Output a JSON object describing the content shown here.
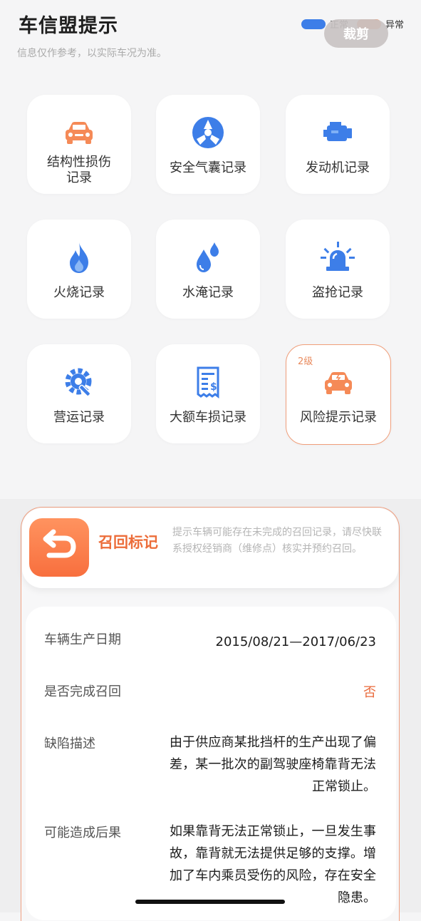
{
  "header": {
    "title": "车信盟提示",
    "subtitle": "信息仅作参考，以实际车况为准。",
    "legend": [
      {
        "label": "正常",
        "color": "#3d7ee8"
      },
      {
        "label": "异常",
        "color": "#f58a57"
      }
    ],
    "crop_button": "裁剪"
  },
  "tiles": [
    {
      "label": "结构性损伤记录",
      "icon": "car-icon",
      "status": "abnormal"
    },
    {
      "label": "安全气囊记录",
      "icon": "airbag-icon",
      "status": "normal"
    },
    {
      "label": "发动机记录",
      "icon": "engine-icon",
      "status": "normal"
    },
    {
      "label": "火烧记录",
      "icon": "fire-icon",
      "status": "normal"
    },
    {
      "label": "水淹记录",
      "icon": "water-drop-icon",
      "status": "normal"
    },
    {
      "label": "盗抢记录",
      "icon": "alarm-light-icon",
      "status": "normal"
    },
    {
      "label": "营运记录",
      "icon": "gear-wrench-icon",
      "status": "normal"
    },
    {
      "label": "大额车损记录",
      "icon": "receipt-icon",
      "status": "normal"
    },
    {
      "label": "风险提示记录",
      "icon": "car-risk-icon",
      "status": "abnormal",
      "level": "2级"
    }
  ],
  "recall": {
    "title": "召回标记",
    "description": "提示车辆可能存在未完成的召回记录，请尽快联系授权经销商（维修点）核实并预约召回。",
    "rows": [
      {
        "key": "车辆生产日期",
        "value": "2015/08/21—2017/06/23"
      },
      {
        "key": "是否完成召回",
        "value": "否"
      },
      {
        "key": "缺陷描述",
        "value": "由于供应商某批挡杆的生产出现了偏差，某一批次的副驾驶座椅靠背无法正常锁止。"
      },
      {
        "key": "可能造成后果",
        "value": "如果靠背无法正常锁止，一旦发生事故，靠背就无法提供足够的支撑。增加了车内乘员受伤的风险，存在安全隐患。"
      }
    ]
  },
  "colors": {
    "accent_orange": "#ec6d3a",
    "accent_blue": "#3d7ee8"
  }
}
